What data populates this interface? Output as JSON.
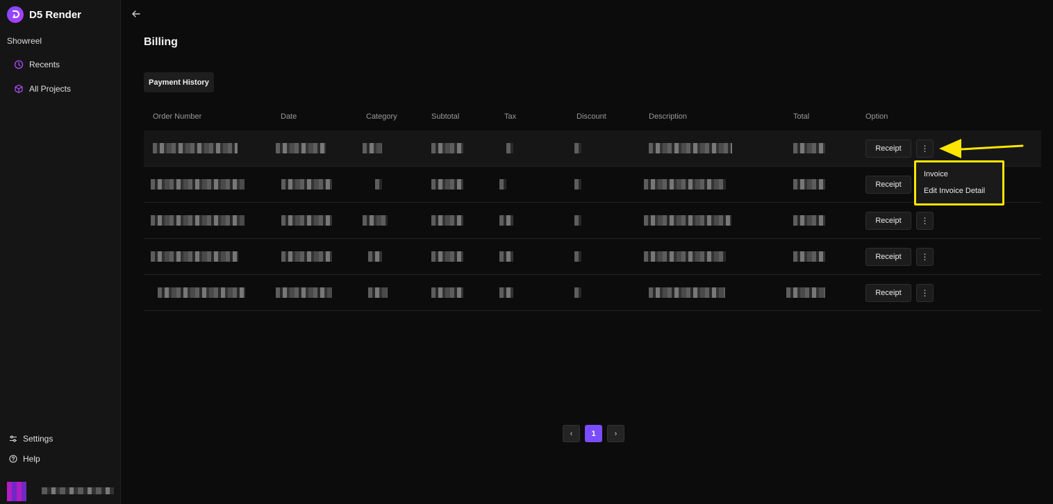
{
  "app": {
    "name": "D5 Render",
    "workspace": "Showreel"
  },
  "sidebar": {
    "items": [
      {
        "label": "Recents",
        "icon": "clock-icon"
      },
      {
        "label": "All Projects",
        "icon": "cube-icon"
      }
    ],
    "bottom": [
      {
        "label": "Settings",
        "icon": "sliders-icon"
      },
      {
        "label": "Help",
        "icon": "help-circle-icon"
      }
    ]
  },
  "page": {
    "title": "Billing",
    "tab": "Payment History"
  },
  "table": {
    "columns": [
      "Order Number",
      "Date",
      "Category",
      "Subtotal",
      "Tax",
      "Discount",
      "Description",
      "Total",
      "Option"
    ],
    "rows": [
      {
        "receipt_label": "Receipt",
        "more_label": "⋮"
      },
      {
        "receipt_label": "Receipt",
        "more_label": "⋮"
      },
      {
        "receipt_label": "Receipt",
        "more_label": "⋮"
      },
      {
        "receipt_label": "Receipt",
        "more_label": "⋮"
      },
      {
        "receipt_label": "Receipt",
        "more_label": "⋮"
      }
    ]
  },
  "dropdown": {
    "items": [
      "Invoice",
      "Edit Invoice Detail"
    ]
  },
  "pagination": {
    "prev": "‹",
    "current": "1",
    "next": "›"
  },
  "colors": {
    "accent": "#7a4dff",
    "annotation": "#ffe600",
    "background": "#0c0c0c",
    "sidebar": "#151515"
  }
}
